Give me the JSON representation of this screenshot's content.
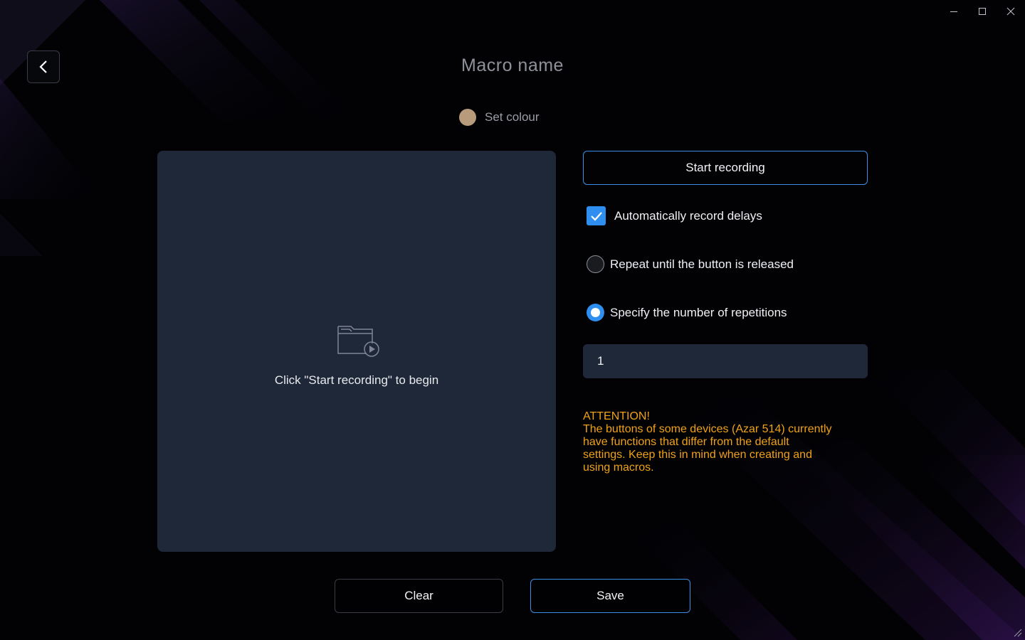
{
  "window": {
    "controls": [
      "minimize-icon",
      "maximize-icon",
      "close-icon"
    ]
  },
  "header": {
    "back_icon": "chevron-left-icon",
    "title": "Macro name",
    "set_colour_label": "Set colour",
    "colour": "#b89b7a"
  },
  "recording_panel": {
    "empty_icon": "folder-play-icon",
    "empty_text": "Click \"Start recording\" to begin"
  },
  "controls": {
    "start_recording_label": "Start recording",
    "auto_delays_label": "Automatically record delays",
    "auto_delays_checked": true,
    "repeat_released_label": "Repeat until the button is released",
    "repeat_released_selected": false,
    "specify_reps_label": "Specify the number of repetitions",
    "specify_reps_selected": true,
    "repetitions_value": "1"
  },
  "attention": {
    "heading": "ATTENTION!",
    "line1": "The buttons of some devices (Azar 514) currently",
    "line2": "have functions that differ from the default",
    "line3": "settings. Keep this in mind when creating and",
    "line4": "using macros."
  },
  "footer": {
    "clear_label": "Clear",
    "save_label": "Save"
  },
  "colors": {
    "accent": "#2f8ff0",
    "panel": "#1e2838",
    "warning": "#f0a216",
    "background": "#020205"
  }
}
